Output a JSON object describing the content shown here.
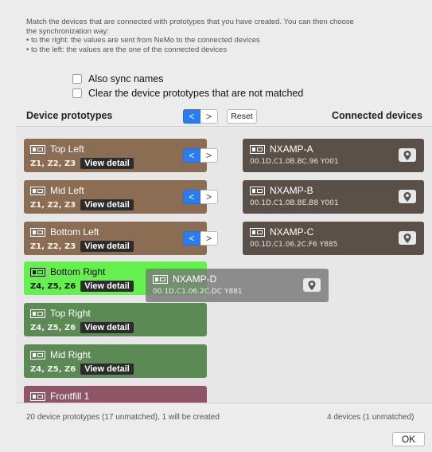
{
  "intro": {
    "line1": "Match the devices that are connected with prototypes that you have created. You can then choose",
    "line2": "the synchronization way:",
    "line3": "• to the right: the values are sent from NeMo to the connected devices",
    "line4": "• to the left: the values are the one of the connected devices"
  },
  "options": {
    "also_sync_names": {
      "label": "Also sync names",
      "checked": false
    },
    "clear_unmatched": {
      "label": "Clear the device prototypes that are not matched",
      "checked": false
    }
  },
  "header": {
    "left_title": "Device prototypes",
    "right_title": "Connected devices",
    "reset_label": "Reset",
    "left_arrow": "<",
    "right_arrow": ">"
  },
  "prototypes": [
    {
      "name": "Top Left",
      "zones": "Z1, Z2, Z3",
      "detail": "View detail"
    },
    {
      "name": "Mid Left",
      "zones": "Z1, Z2, Z3",
      "detail": "View detail"
    },
    {
      "name": "Bottom Left",
      "zones": "Z1, Z2, Z3",
      "detail": "View detail"
    },
    {
      "name": "Bottom Right",
      "zones": "Z4, Z5, Z6",
      "detail": "View detail"
    },
    {
      "name": "Top Right",
      "zones": "Z4, Z5, Z6",
      "detail": "View detail"
    },
    {
      "name": "Mid Right",
      "zones": "Z4, Z5, Z6",
      "detail": "View detail"
    },
    {
      "name": "Frontfill 1"
    }
  ],
  "devices": [
    {
      "name": "NXAMP-A",
      "id": "00.1D.C1.0B.BC.96  Y001"
    },
    {
      "name": "NXAMP-B",
      "id": "00.1D.C1.0B.BE.B8  Y001"
    },
    {
      "name": "NXAMP-C",
      "id": "00.1D.C1.06.2C.F6  Y885"
    }
  ],
  "dragging": {
    "name": "NXAMP-D",
    "id": "00.1D.C1.06.2C.DC  Y881"
  },
  "footer": {
    "left": "20 device prototypes (17 unmatched), 1 will be created",
    "right": "4 devices (1 unmatched)",
    "ok": "OK"
  },
  "colors": {
    "matched_prototype": "#8a6d52",
    "unmatched_prototype": "#5c8a54",
    "highlight_prototype": "#66f04f",
    "frontfill_prototype": "#8c5667",
    "connected_device": "#5a5048",
    "accent": "#2a7cf0"
  },
  "icons": {
    "device": "device-icon",
    "locate": "pin-icon",
    "arrow_left": "chevron-left-icon",
    "arrow_right": "chevron-right-icon"
  }
}
